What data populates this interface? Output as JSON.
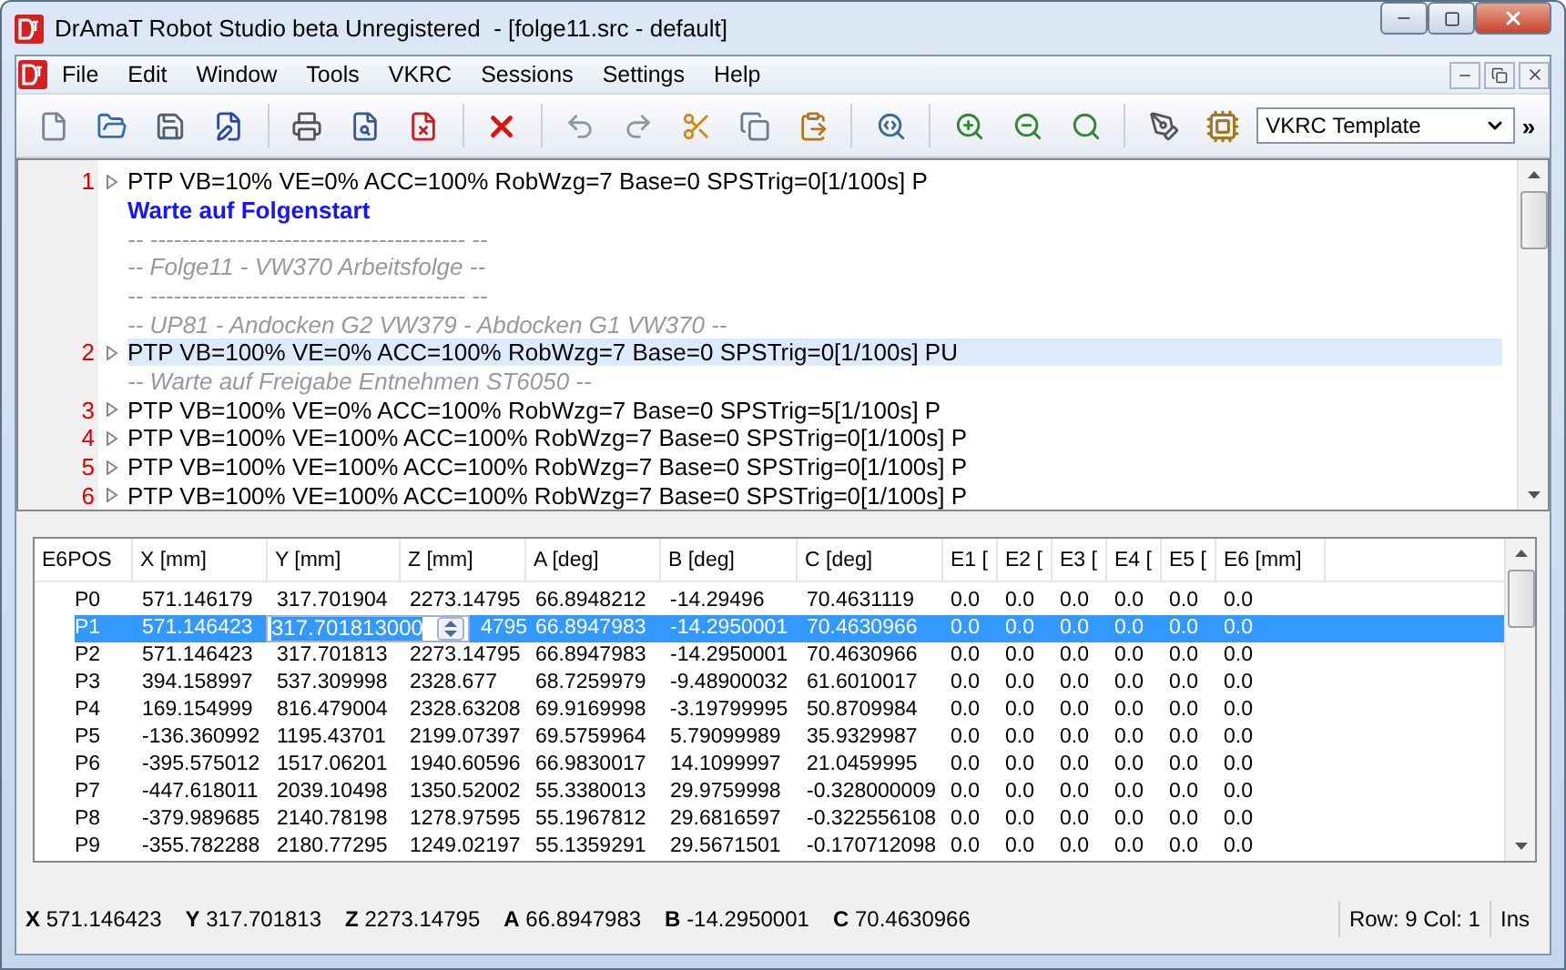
{
  "window": {
    "title": "DrAmaT Robot Studio beta Unregistered  - [folge11.src - default]"
  },
  "menu": [
    "File",
    "Edit",
    "Window",
    "Tools",
    "VKRC",
    "Sessions",
    "Settings",
    "Help"
  ],
  "toolbar": {
    "template": "VKRC Template",
    "overflow": "»"
  },
  "editor": {
    "lines": [
      {
        "kind": "code",
        "number": "1",
        "text": "PTP VB=10% VE=0% ACC=100% RobWzg=7 Base=0 SPSTrig=0[1/100s] P",
        "selected": false
      },
      {
        "kind": "label",
        "text": "Warte auf Folgenstart"
      },
      {
        "kind": "comment",
        "text": "-- ---------------------------------------- --"
      },
      {
        "kind": "comment",
        "text": "-- Folge11 - VW370 Arbeitsfolge --"
      },
      {
        "kind": "comment",
        "text": "-- ---------------------------------------- --"
      },
      {
        "kind": "comment",
        "text": "-- UP81 - Andocken G2 VW379 - Abdocken G1 VW370 --"
      },
      {
        "kind": "code",
        "number": "2",
        "text": "PTP VB=100% VE=0% ACC=100% RobWzg=7 Base=0 SPSTrig=0[1/100s] PU",
        "selected": true
      },
      {
        "kind": "comment",
        "text": "-- Warte auf Freigabe Entnehmen ST6050 --"
      },
      {
        "kind": "code",
        "number": "3",
        "text": "PTP VB=100% VE=0% ACC=100% RobWzg=7 Base=0 SPSTrig=5[1/100s] P",
        "selected": false
      },
      {
        "kind": "code",
        "number": "4",
        "text": "PTP VB=100% VE=100% ACC=100% RobWzg=7 Base=0 SPSTrig=0[1/100s] P",
        "selected": false
      },
      {
        "kind": "code",
        "number": "5",
        "text": "PTP VB=100% VE=100% ACC=100% RobWzg=7 Base=0 SPSTrig=0[1/100s] P",
        "selected": false
      },
      {
        "kind": "code",
        "number": "6",
        "text": "PTP VB=100% VE=100% ACC=100% RobWzg=7 Base=0 SPSTrig=0[1/100s] P",
        "selected": false
      }
    ]
  },
  "table": {
    "columns": [
      "E6POS",
      "X [mm]",
      "Y [mm]",
      "Z [mm]",
      "A [deg]",
      "B [deg]",
      "C [deg]",
      "E1 [",
      "E2 [",
      "E3 [",
      "E4 [",
      "E5 [",
      "E6 [mm]"
    ],
    "rows": [
      {
        "selected": false,
        "cells": [
          "P0",
          "571.146179",
          "317.701904",
          "2273.14795",
          "66.8948212",
          "-14.29496",
          "70.4631119",
          "0.0",
          "0.0",
          "0.0",
          "0.0",
          "0.0",
          "0.0"
        ]
      },
      {
        "selected": true,
        "cells": [
          "P1",
          "571.146423",
          {
            "kind": "spin",
            "value": "317.701813000"
          },
          "4795",
          "66.8947983",
          "-14.2950001",
          "70.4630966",
          "0.0",
          "0.0",
          "0.0",
          "0.0",
          "0.0",
          "0.0"
        ]
      },
      {
        "selected": false,
        "cells": [
          "P2",
          "571.146423",
          "317.701813",
          "2273.14795",
          "66.8947983",
          "-14.2950001",
          "70.4630966",
          "0.0",
          "0.0",
          "0.0",
          "0.0",
          "0.0",
          "0.0"
        ]
      },
      {
        "selected": false,
        "cells": [
          "P3",
          "394.158997",
          "537.309998",
          "2328.677",
          "68.7259979",
          "-9.48900032",
          "61.6010017",
          "0.0",
          "0.0",
          "0.0",
          "0.0",
          "0.0",
          "0.0"
        ]
      },
      {
        "selected": false,
        "cells": [
          "P4",
          "169.154999",
          "816.479004",
          "2328.63208",
          "69.9169998",
          "-3.19799995",
          "50.8709984",
          "0.0",
          "0.0",
          "0.0",
          "0.0",
          "0.0",
          "0.0"
        ]
      },
      {
        "selected": false,
        "cells": [
          "P5",
          "-136.360992",
          "1195.43701",
          "2199.07397",
          "69.5759964",
          "5.79099989",
          "35.9329987",
          "0.0",
          "0.0",
          "0.0",
          "0.0",
          "0.0",
          "0.0"
        ]
      },
      {
        "selected": false,
        "cells": [
          "P6",
          "-395.575012",
          "1517.06201",
          "1940.60596",
          "66.9830017",
          "14.1099997",
          "21.0459995",
          "0.0",
          "0.0",
          "0.0",
          "0.0",
          "0.0",
          "0.0"
        ]
      },
      {
        "selected": false,
        "cells": [
          "P7",
          "-447.618011",
          "2039.10498",
          "1350.52002",
          "55.3380013",
          "29.9759998",
          "-0.328000009",
          "0.0",
          "0.0",
          "0.0",
          "0.0",
          "0.0",
          "0.0"
        ]
      },
      {
        "selected": false,
        "cells": [
          "P8",
          "-379.989685",
          "2140.78198",
          "1278.97595",
          "55.1967812",
          "29.6816597",
          "-0.322556108",
          "0.0",
          "0.0",
          "0.0",
          "0.0",
          "0.0",
          "0.0"
        ]
      },
      {
        "selected": false,
        "cells": [
          "P9",
          "-355.782288",
          "2180.77295",
          "1249.02197",
          "55.1359291",
          "29.5671501",
          "-0.170712098",
          "0.0",
          "0.0",
          "0.0",
          "0.0",
          "0.0",
          "0.0"
        ]
      }
    ]
  },
  "status_bar": {
    "values": [
      {
        "label": "X",
        "value": "571.146423"
      },
      {
        "label": "Y",
        "value": "317.701813"
      },
      {
        "label": "Z",
        "value": "2273.14795"
      },
      {
        "label": "A",
        "value": "66.8947983"
      },
      {
        "label": "B",
        "value": "-14.2950001"
      },
      {
        "label": "C",
        "value": "70.4630966"
      }
    ],
    "position": "Row: 9 Col: 1",
    "mode": "Ins"
  }
}
